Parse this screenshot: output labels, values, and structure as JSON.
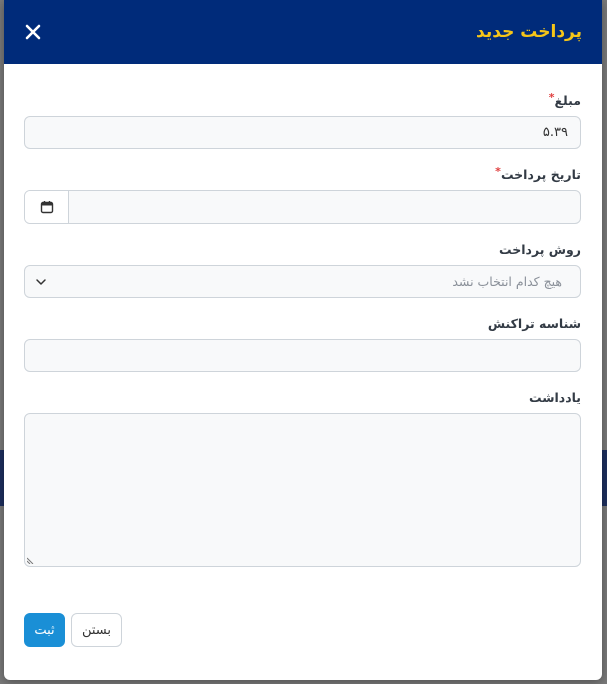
{
  "modal": {
    "title": "پرداخت جدید",
    "close_icon": "close-icon",
    "colors": {
      "header_bg": "#002b7a",
      "title_color": "#f5c518",
      "primary_button": "#1a8fd6",
      "required_marker": "#e04040"
    }
  },
  "form": {
    "amount": {
      "label": "مبلغ",
      "required_mark": "*",
      "value": "۵.۳۹"
    },
    "payment_date": {
      "label": "تاریخ پرداخت",
      "required_mark": "*",
      "value": "",
      "button_icon": "calendar-icon"
    },
    "payment_method": {
      "label": "روش پرداخت",
      "placeholder": "هیچ کدام انتخاب نشد",
      "icon": "chevron-down-icon"
    },
    "transaction_id": {
      "label": "شناسه تراکنش",
      "value": ""
    },
    "note": {
      "label": "یادداشت",
      "value": ""
    }
  },
  "footer": {
    "submit_label": "ثبت",
    "close_label": "بستن"
  }
}
